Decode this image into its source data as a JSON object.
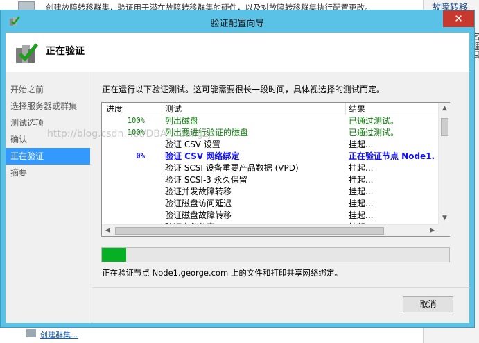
{
  "background": {
    "top_text": "创建故障转移群集，验证用于潜在故障转移群集的硬件，以及对故障转移群集执行配置更改。",
    "right_panel_title": "故障转移",
    "right_chars": [
      "名",
      "理",
      "耳"
    ],
    "bottom_link": "创建群集..."
  },
  "window": {
    "title": "验证配置向导",
    "close_glyph": "✕"
  },
  "header": {
    "title": "正在验证"
  },
  "nav": {
    "items": [
      "开始之前",
      "选择服务器或群集",
      "测试选项",
      "确认",
      "正在验证",
      "摘要"
    ],
    "active_index": 4
  },
  "content": {
    "description": "正在运行以下验证测试。这可能需要很长一段时间，具体视选择的测试而定。",
    "columns": {
      "progress": "进度",
      "test": "测试",
      "result": "结果"
    },
    "rows": [
      {
        "progress": "100%",
        "test": "列出磁盘",
        "result": "已通过测试。",
        "state": "pass"
      },
      {
        "progress": "100%",
        "test": "列出要进行验证的磁盘",
        "result": "已通过测试。",
        "state": "pass"
      },
      {
        "progress": "",
        "test": "验证 CSV 设置",
        "result": "挂起...",
        "state": "pending"
      },
      {
        "progress": "0%",
        "test": "验证 CSV 网络绑定",
        "result": "正在验证节点 Node1.",
        "state": "active"
      },
      {
        "progress": "",
        "test": "验证 SCSI 设备重要产品数据 (VPD)",
        "result": "挂起...",
        "state": "pending"
      },
      {
        "progress": "",
        "test": "验证 SCSI-3 永久保留",
        "result": "挂起...",
        "state": "pending"
      },
      {
        "progress": "",
        "test": "验证并发故障转移",
        "result": "挂起...",
        "state": "pending"
      },
      {
        "progress": "",
        "test": "验证磁盘访问延迟",
        "result": "挂起...",
        "state": "pending"
      },
      {
        "progress": "",
        "test": "验证磁盘故障转移",
        "result": "挂起...",
        "state": "pending"
      },
      {
        "progress": "",
        "test": "验证文件共享",
        "result": "挂起...",
        "state": "pending"
      }
    ],
    "progress_fraction": 0.07,
    "status_text": "正在验证节点 Node1.george.com 上的文件和打印共享网络绑定。",
    "watermark": "http://blog.csdn.net/DBA_Huangzj",
    "cancel_label": "取消"
  },
  "colors": {
    "titlebar": "#5bc2e7",
    "close": "#c7382e",
    "nav_active": "#3399ff",
    "pass_text": "#108010",
    "active_text": "#1010ff",
    "progress_fill": "#06b025"
  }
}
